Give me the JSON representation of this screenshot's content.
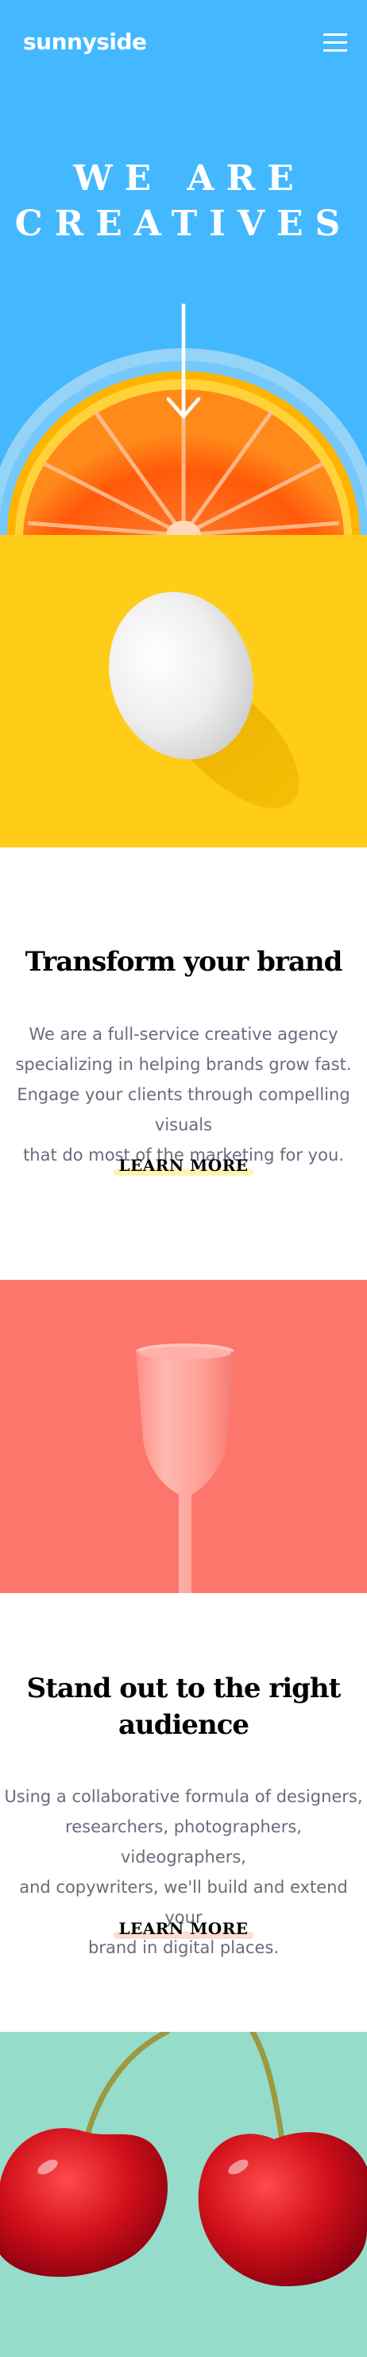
{
  "header": {
    "logo": "sunnyside",
    "menu_icon": "hamburger-menu-icon"
  },
  "hero": {
    "title_line1": "WE ARE",
    "title_line2": "CREATIVES",
    "arrow_icon": "arrow-down-icon",
    "background_color": "#44b8ff"
  },
  "sections": {
    "transform": {
      "title": "Transform your brand",
      "body_lines": [
        "We are a full-service creative agency",
        "specializing in helping brands grow fast.",
        "Engage your clients through compelling visuals",
        "that do most of the marketing for you."
      ],
      "cta": "LEARN MORE",
      "cta_accent": "#fff3b3"
    },
    "standout": {
      "title_line1": "Stand out to the right",
      "title_line2": "audience",
      "body_lines": [
        "Using a collaborative formula of designers,",
        "researchers, photographers, videographers,",
        "and copywriters, we'll build and extend your",
        "brand in digital places."
      ],
      "cta": "LEARN MORE",
      "cta_accent": "#fcdcd5"
    }
  },
  "colors": {
    "egg_background": "#ffcd18",
    "glass_background": "#fc766b",
    "cherry_background": "#96dccb",
    "body_text": "#6b6a7d"
  }
}
